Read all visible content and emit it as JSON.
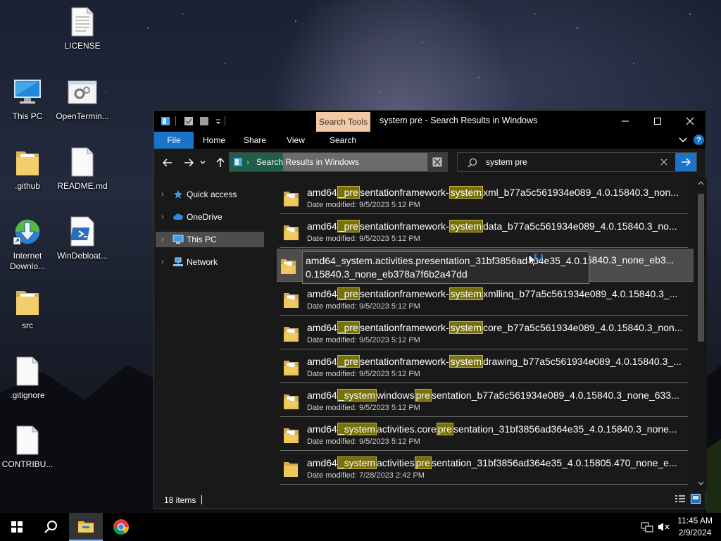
{
  "desktop": {
    "icons": [
      {
        "label": "LICENSE",
        "icon": "text-file-icon"
      },
      {
        "label": "This PC",
        "icon": "this-pc-icon"
      },
      {
        "label": "OpenTermin...",
        "icon": "settings-app-icon"
      },
      {
        "label": ".github",
        "icon": "folder-icon"
      },
      {
        "label": "README.md",
        "icon": "blank-file-icon"
      },
      {
        "label": "Internet Downlo...",
        "icon": "internet-download-manager-icon"
      },
      {
        "label": "WinDebloat...",
        "icon": "powershell-script-icon"
      },
      {
        "label": "src",
        "icon": "folder-icon"
      },
      {
        "label": ".gitignore",
        "icon": "blank-file-icon"
      },
      {
        "label": "CONTRIBU...",
        "icon": "blank-file-icon"
      }
    ]
  },
  "explorer": {
    "title": "system pre - Search Results in Windows",
    "context_tab": "Search Tools",
    "ribbon_tabs": [
      "File",
      "Home",
      "Share",
      "View",
      "Search"
    ],
    "address": {
      "breadcrumb": "Search Results in Windows",
      "separator": "›"
    },
    "search": {
      "value": "system pre"
    },
    "nav": {
      "items": [
        {
          "label": "Quick access",
          "icon": "star-icon"
        },
        {
          "label": "OneDrive",
          "icon": "cloud-icon"
        },
        {
          "label": "This PC",
          "icon": "monitor-icon",
          "selected": true
        },
        {
          "label": "Network",
          "icon": "network-icon"
        }
      ]
    },
    "date_prefix": "Date modified: ",
    "results": [
      {
        "parts": [
          "amd64",
          "_pre",
          "sentationframework-",
          "system",
          "xml_b77a5c561934e089_4.0.15840.3_non..."
        ],
        "hl": [
          1,
          3
        ],
        "date": "9/5/2023 5:12 PM"
      },
      {
        "parts": [
          "amd64",
          "_pre",
          "sentationframework-",
          "system",
          "data_b77a5c561934e089_4.0.15840.3_no..."
        ],
        "hl": [
          1,
          3
        ],
        "date": "9/5/2023 5:12 PM"
      },
      {
        "parts": [
          "amd64_system.activities.presentation_31bf3856a",
          "d364e35_4.0.15840.3_none_eb3..."
        ],
        "hl": [],
        "date": "",
        "hover": true
      },
      {
        "parts": [
          "amd64",
          "_pre",
          "sentationframework-",
          "system",
          "xmllinq_b77a5c561934e089_4.0.15840.3_..."
        ],
        "hl": [
          1,
          3
        ],
        "date": "9/5/2023 5:12 PM"
      },
      {
        "parts": [
          "amd64",
          "_pre",
          "sentationframework-",
          "system",
          "core_b77a5c561934e089_4.0.15840.3_non..."
        ],
        "hl": [
          1,
          3
        ],
        "date": "9/5/2023 5:12 PM"
      },
      {
        "parts": [
          "amd64",
          "_pre",
          "sentationframework-",
          "system",
          "drawing_b77a5c561934e089_4.0.15840.3_..."
        ],
        "hl": [
          1,
          3
        ],
        "date": "9/5/2023 5:12 PM"
      },
      {
        "parts": [
          "amd64",
          "_system",
          "windows",
          "pre",
          "sentation_b77a5c561934e089_4.0.15840.3_none_633..."
        ],
        "hl": [
          1,
          3
        ],
        "date": "9/5/2023 5:12 PM"
      },
      {
        "parts": [
          "amd64",
          "_system",
          "activities.core",
          "pre",
          "sentation_31bf3856ad364e35_4.0.15840.3_none..."
        ],
        "hl": [
          1,
          3
        ],
        "date": "9/5/2023 5:12 PM"
      },
      {
        "parts": [
          "amd64",
          "_system",
          "activities",
          "pre",
          "sentation_31bf3856ad364e35_4.0.15805.470_none_e..."
        ],
        "hl": [
          1,
          3
        ],
        "date": "7/28/2023 2:42 PM",
        "folder": true
      }
    ],
    "tooltip": {
      "line1": "amd64_system.activities.presentation_31bf3856ad364e35_4.0.15840.3_none_eb3...",
      "line2": "0.15840.3_none_eb378a7f6b2a47dd"
    },
    "status": {
      "count": "18 items"
    }
  },
  "taskbar": {
    "time": "11:45 AM",
    "date": "2/9/2024",
    "apps": [
      "windows-start-icon",
      "search-icon",
      "file-explorer-icon",
      "chrome-icon"
    ]
  },
  "colors": {
    "accent": "#1b73c9",
    "highlight": "#78700b",
    "context_tab": "#f2c9a4",
    "selection": "#4d4d4d"
  }
}
